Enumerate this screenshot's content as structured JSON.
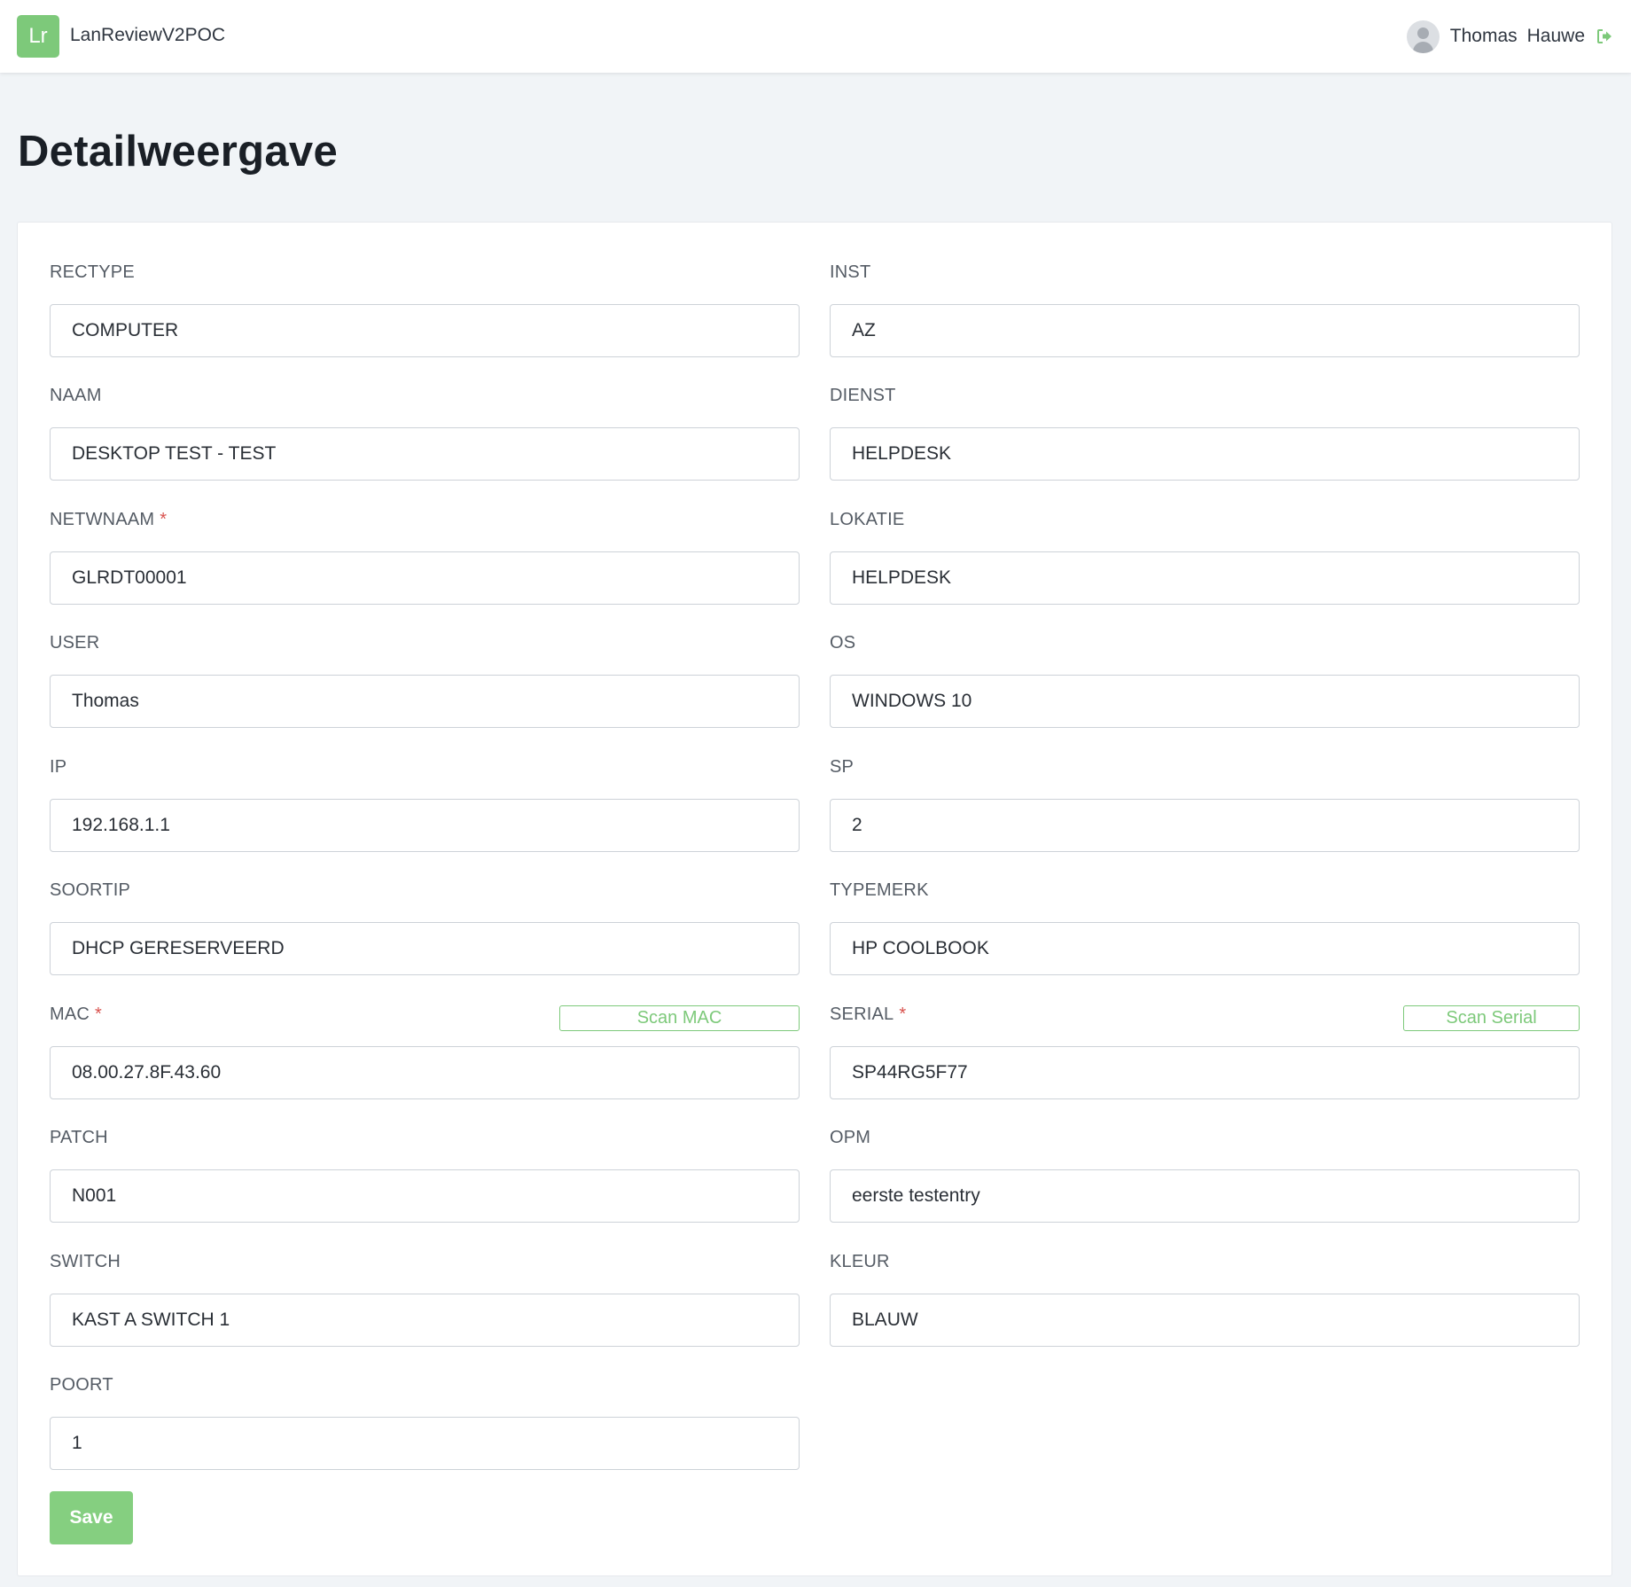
{
  "app": {
    "logo_text": "Lr",
    "name": "LanReviewV2POC"
  },
  "user": {
    "first_name": "Thomas",
    "last_name": "Hauwe"
  },
  "page": {
    "title": "Detailweergave"
  },
  "colors": {
    "accent": "#7dc97a",
    "required": "#d9534f",
    "background": "#f1f4f7"
  },
  "icons": {
    "avatar": "user-avatar-icon",
    "logout": "sign-out-icon"
  },
  "form": {
    "fields": {
      "rectype": {
        "label": "RECTYPE",
        "value": "COMPUTER"
      },
      "inst": {
        "label": "INST",
        "value": "AZ"
      },
      "naam": {
        "label": "NAAM",
        "value": "DESKTOP TEST - TEST"
      },
      "dienst": {
        "label": "DIENST",
        "value": "HELPDESK"
      },
      "netwnaam": {
        "label": "NETWNAAM",
        "required": "*",
        "value": "GLRDT00001"
      },
      "lokatie": {
        "label": "LOKATIE",
        "value": "HELPDESK"
      },
      "user": {
        "label": "USER",
        "value": "Thomas"
      },
      "os": {
        "label": "OS",
        "value": "WINDOWS 10"
      },
      "ip": {
        "label": "IP",
        "value": "192.168.1.1"
      },
      "sp": {
        "label": "SP",
        "value": "2"
      },
      "soortip": {
        "label": "SOORTIP",
        "value": "DHCP GERESERVEERD"
      },
      "typemerk": {
        "label": "TYPEMERK",
        "value": "HP COOLBOOK"
      },
      "mac": {
        "label": "MAC",
        "required": "*",
        "value": "08.00.27.8F.43.60",
        "scan_label": "Scan MAC"
      },
      "serial": {
        "label": "SERIAL",
        "required": "*",
        "value": "SP44RG5F77",
        "scan_label": "Scan Serial"
      },
      "patch": {
        "label": "PATCH",
        "value": "N001"
      },
      "opm": {
        "label": "OPM",
        "value": "eerste testentry"
      },
      "switch": {
        "label": "SWITCH",
        "value": "KAST A SWITCH 1"
      },
      "kleur": {
        "label": "KLEUR",
        "value": "BLAUW"
      },
      "poort": {
        "label": "POORT",
        "value": "1"
      }
    },
    "save_label": "Save"
  }
}
